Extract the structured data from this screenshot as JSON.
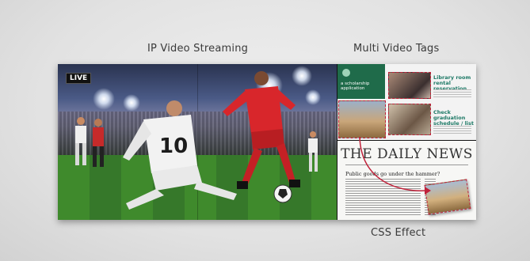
{
  "labels": {
    "ip_streaming": "IP Video Streaming",
    "multi_video_tags": "Multi Video Tags",
    "css_effect": "CSS Effect"
  },
  "stadium": {
    "live_badge": "LIVE",
    "jersey_number": "10"
  },
  "tags_panel": {
    "green_tile_text": "a scholarship application",
    "tag1_title": "Library room rental reservation",
    "tag2_title": "Check graduation schedule / list"
  },
  "news_panel": {
    "masthead": "THE DAILY NEWS",
    "headline": "Public goods go under the hammer?"
  },
  "colors": {
    "accent_red": "#c0213a",
    "tag_green": "#1f7a67"
  }
}
